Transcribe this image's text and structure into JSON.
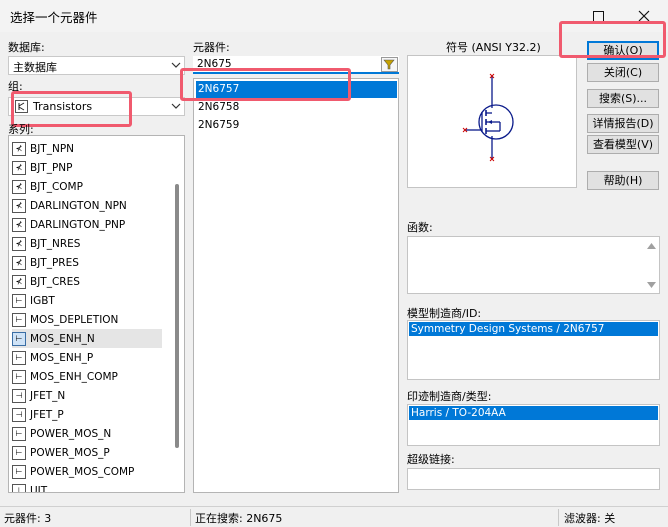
{
  "window": {
    "title": "选择一个元器件"
  },
  "left": {
    "database_label": "数据库:",
    "database_value": "主数据库",
    "group_label": "组:",
    "group_value": "Transistors",
    "series_label": "系列:",
    "series": [
      {
        "label": "BJT_NPN"
      },
      {
        "label": "BJT_PNP"
      },
      {
        "label": "BJT_COMP"
      },
      {
        "label": "DARLINGTON_NPN"
      },
      {
        "label": "DARLINGTON_PNP"
      },
      {
        "label": "BJT_NRES"
      },
      {
        "label": "BJT_PRES"
      },
      {
        "label": "BJT_CRES"
      },
      {
        "label": "IGBT"
      },
      {
        "label": "MOS_DEPLETION"
      },
      {
        "label": "MOS_ENH_N"
      },
      {
        "label": "MOS_ENH_P"
      },
      {
        "label": "MOS_ENH_COMP"
      },
      {
        "label": "JFET_N"
      },
      {
        "label": "JFET_P"
      },
      {
        "label": "POWER_MOS_N"
      },
      {
        "label": "POWER_MOS_P"
      },
      {
        "label": "POWER_MOS_COMP"
      },
      {
        "label": "UJT"
      }
    ]
  },
  "middle": {
    "component_label": "元器件:",
    "search_value": "2N675",
    "components": [
      {
        "label": "2N6757"
      },
      {
        "label": "2N6758"
      },
      {
        "label": "2N6759"
      }
    ]
  },
  "symbol": {
    "label": "符号 (ANSI Y32.2)"
  },
  "info": {
    "function_label": "函数:",
    "model_label": "模型制造商/ID:",
    "model_value": "Symmetry Design Systems / 2N6757",
    "footprint_label": "印迹制造商/类型:",
    "footprint_value": "Harris / TO-204AA",
    "hyperlink_label": "超级链接:"
  },
  "buttons": {
    "ok": "确认(O)",
    "close": "关闭(C)",
    "search": "搜索(S)...",
    "report": "详情报告(D)",
    "view_model": "查看模型(V)",
    "help": "帮助(H)"
  },
  "status": {
    "components": "元器件: 3",
    "searching": "正在搜索: 2N675",
    "filter": "滤波器: 关"
  },
  "colors": {
    "selection": "#0078d7",
    "highlight_box": "#f05a6e"
  }
}
